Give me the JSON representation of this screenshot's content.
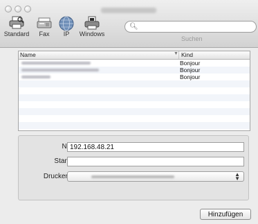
{
  "toolbar": {
    "items": [
      {
        "label": "Standard"
      },
      {
        "label": "Fax"
      },
      {
        "label": "IP"
      },
      {
        "label": "Windows"
      }
    ],
    "search_caption": "Suchen"
  },
  "list": {
    "col_name": "Name",
    "col_kind": "Kind",
    "rows": [
      {
        "kind": "Bonjour"
      },
      {
        "kind": "Bonjour"
      },
      {
        "kind": "Bonjour"
      }
    ]
  },
  "form": {
    "name_label": "Name:",
    "name_value": "192.168.48.21",
    "location_label": "Standort:",
    "location_value": "",
    "use_label": "Drucken mit:"
  },
  "add_button": "Hinzufügen",
  "colors": {
    "window_bg": "#ececec",
    "alt_row": "#f2f5fa"
  }
}
